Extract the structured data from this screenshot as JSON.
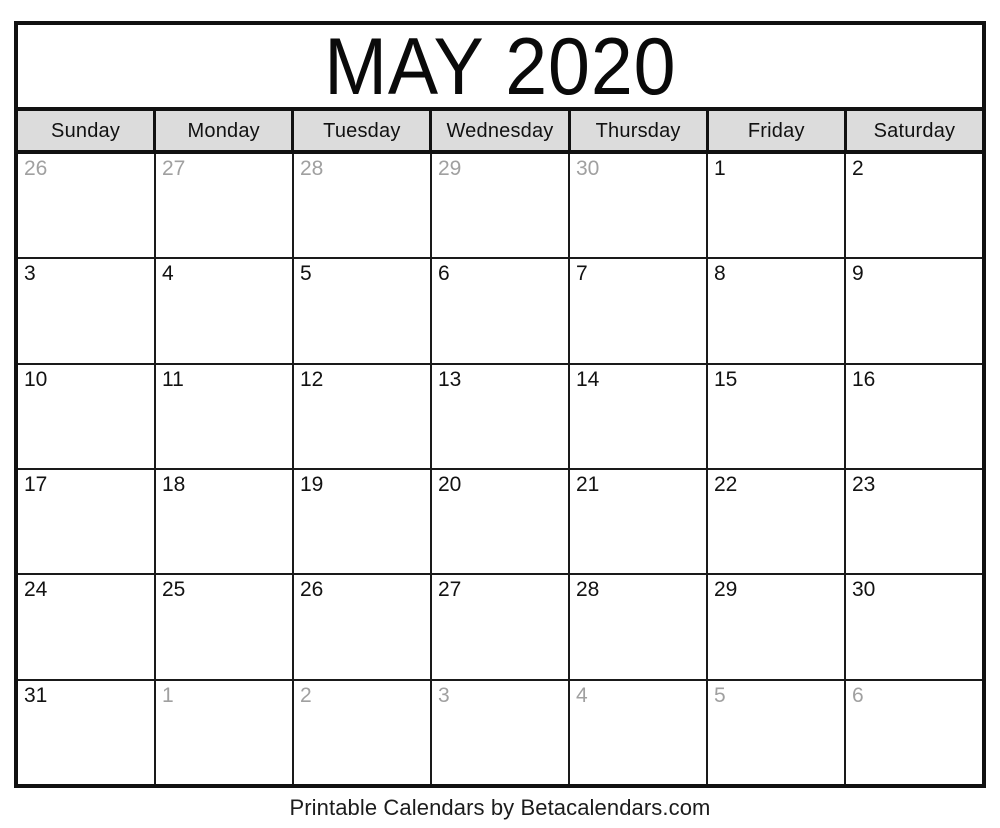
{
  "calendar": {
    "title": "MAY 2020",
    "month": "May",
    "year": "2020",
    "weekdays": [
      {
        "label": "Sunday"
      },
      {
        "label": "Monday"
      },
      {
        "label": "Tuesday"
      },
      {
        "label": "Wednesday"
      },
      {
        "label": "Thursday"
      },
      {
        "label": "Friday"
      },
      {
        "label": "Saturday"
      }
    ],
    "weeks": [
      [
        {
          "day": "26",
          "outside": true
        },
        {
          "day": "27",
          "outside": true
        },
        {
          "day": "28",
          "outside": true
        },
        {
          "day": "29",
          "outside": true
        },
        {
          "day": "30",
          "outside": true
        },
        {
          "day": "1",
          "outside": false
        },
        {
          "day": "2",
          "outside": false
        }
      ],
      [
        {
          "day": "3",
          "outside": false
        },
        {
          "day": "4",
          "outside": false
        },
        {
          "day": "5",
          "outside": false
        },
        {
          "day": "6",
          "outside": false
        },
        {
          "day": "7",
          "outside": false
        },
        {
          "day": "8",
          "outside": false
        },
        {
          "day": "9",
          "outside": false
        }
      ],
      [
        {
          "day": "10",
          "outside": false
        },
        {
          "day": "11",
          "outside": false
        },
        {
          "day": "12",
          "outside": false
        },
        {
          "day": "13",
          "outside": false
        },
        {
          "day": "14",
          "outside": false
        },
        {
          "day": "15",
          "outside": false
        },
        {
          "day": "16",
          "outside": false
        }
      ],
      [
        {
          "day": "17",
          "outside": false
        },
        {
          "day": "18",
          "outside": false
        },
        {
          "day": "19",
          "outside": false
        },
        {
          "day": "20",
          "outside": false
        },
        {
          "day": "21",
          "outside": false
        },
        {
          "day": "22",
          "outside": false
        },
        {
          "day": "23",
          "outside": false
        }
      ],
      [
        {
          "day": "24",
          "outside": false
        },
        {
          "day": "25",
          "outside": false
        },
        {
          "day": "26",
          "outside": false
        },
        {
          "day": "27",
          "outside": false
        },
        {
          "day": "28",
          "outside": false
        },
        {
          "day": "29",
          "outside": false
        },
        {
          "day": "30",
          "outside": false
        }
      ],
      [
        {
          "day": "31",
          "outside": false
        },
        {
          "day": "1",
          "outside": true
        },
        {
          "day": "2",
          "outside": true
        },
        {
          "day": "3",
          "outside": true
        },
        {
          "day": "4",
          "outside": true
        },
        {
          "day": "5",
          "outside": true
        },
        {
          "day": "6",
          "outside": true
        }
      ]
    ]
  },
  "footer": {
    "credit": "Printable Calendars by Betacalendars.com"
  },
  "colors": {
    "border": "#111111",
    "grid_line": "#1a1a1a",
    "header_background": "#dcdcdc",
    "day_text": "#121212",
    "outside_day_text": "#a0a0a0",
    "page_background": "#ffffff"
  }
}
